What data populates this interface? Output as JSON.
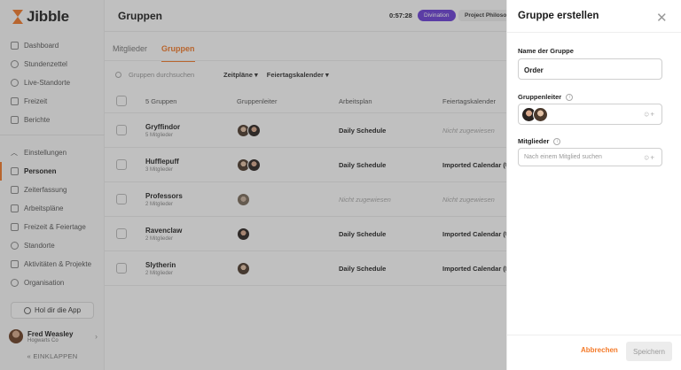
{
  "app": {
    "logo": "Jibble"
  },
  "sidebar": {
    "items": [
      {
        "label": "Dashboard",
        "icon": "dashboard-icon"
      },
      {
        "label": "Stundenzettel",
        "icon": "clock-icon"
      },
      {
        "label": "Live-Standorte",
        "icon": "location-icon"
      },
      {
        "label": "Freizeit",
        "icon": "calendar-icon"
      },
      {
        "label": "Berichte",
        "icon": "report-icon"
      }
    ],
    "settings_items": [
      {
        "label": "Einstellungen",
        "icon": "chevron-up-icon"
      },
      {
        "label": "Personen",
        "icon": "people-icon",
        "active": true
      },
      {
        "label": "Zeiterfassung",
        "icon": "time-tracking-icon"
      },
      {
        "label": "Arbeitspläne",
        "icon": "schedule-icon"
      },
      {
        "label": "Freizeit & Feiertage",
        "icon": "holiday-icon"
      },
      {
        "label": "Standorte",
        "icon": "location-icon"
      },
      {
        "label": "Aktivitäten & Projekte",
        "icon": "tag-icon"
      },
      {
        "label": "Organisation",
        "icon": "gear-icon"
      }
    ],
    "get_app": "Hol dir die App",
    "user": {
      "name": "Fred Weasley",
      "org": "Hogwarts Co"
    },
    "collapse": "« EINKLAPPEN"
  },
  "header": {
    "title": "Gruppen",
    "timer": "0:57:28",
    "activity": "Divination",
    "project": "Project Philosop"
  },
  "tabs": [
    {
      "label": "Mitglieder",
      "active": false
    },
    {
      "label": "Gruppen",
      "active": true
    }
  ],
  "filters": {
    "search_placeholder": "Gruppen durchsuchen",
    "schedules": "Zeitpläne ▾",
    "holidays": "Feiertagskalender ▾"
  },
  "table": {
    "headers": {
      "name": "5 Gruppen",
      "lead": "Gruppenleiter",
      "plan": "Arbeitsplan",
      "calendar": "Feiertagskalender"
    },
    "rows": [
      {
        "name": "Gryffindor",
        "count": "5 Mitglieder",
        "plan": "Daily Schedule",
        "calendar": "Nicht zugewiesen",
        "cal_muted": true,
        "leads": 2
      },
      {
        "name": "Hufflepuff",
        "count": "3 Mitglieder",
        "plan": "Daily Schedule",
        "calendar": "Imported Calendar (U",
        "cal_muted": false,
        "leads": 2
      },
      {
        "name": "Professors",
        "count": "2 Mitglieder",
        "plan": "Nicht zugewiesen",
        "calendar": "Nicht zugewiesen",
        "plan_muted": true,
        "cal_muted": true,
        "leads": 1
      },
      {
        "name": "Ravenclaw",
        "count": "2 Mitglieder",
        "plan": "Daily Schedule",
        "calendar": "Imported Calendar (U",
        "cal_muted": false,
        "leads": 1
      },
      {
        "name": "Slytherin",
        "count": "2 Mitglieder",
        "plan": "Daily Schedule",
        "calendar": "Imported Calendar (Fr",
        "cal_muted": false,
        "leads": 1
      }
    ]
  },
  "panel": {
    "title": "Gruppe erstellen",
    "name_label": "Name der Gruppe",
    "name_value": "Order",
    "lead_label": "Gruppenleiter",
    "members_label": "Mitglieder",
    "members_placeholder": "Nach einem Mitglied suchen",
    "cancel": "Abbrechen",
    "save": "Speichern"
  },
  "colors": {
    "accent": "#f47a29",
    "badge": "#6b3fd8"
  }
}
